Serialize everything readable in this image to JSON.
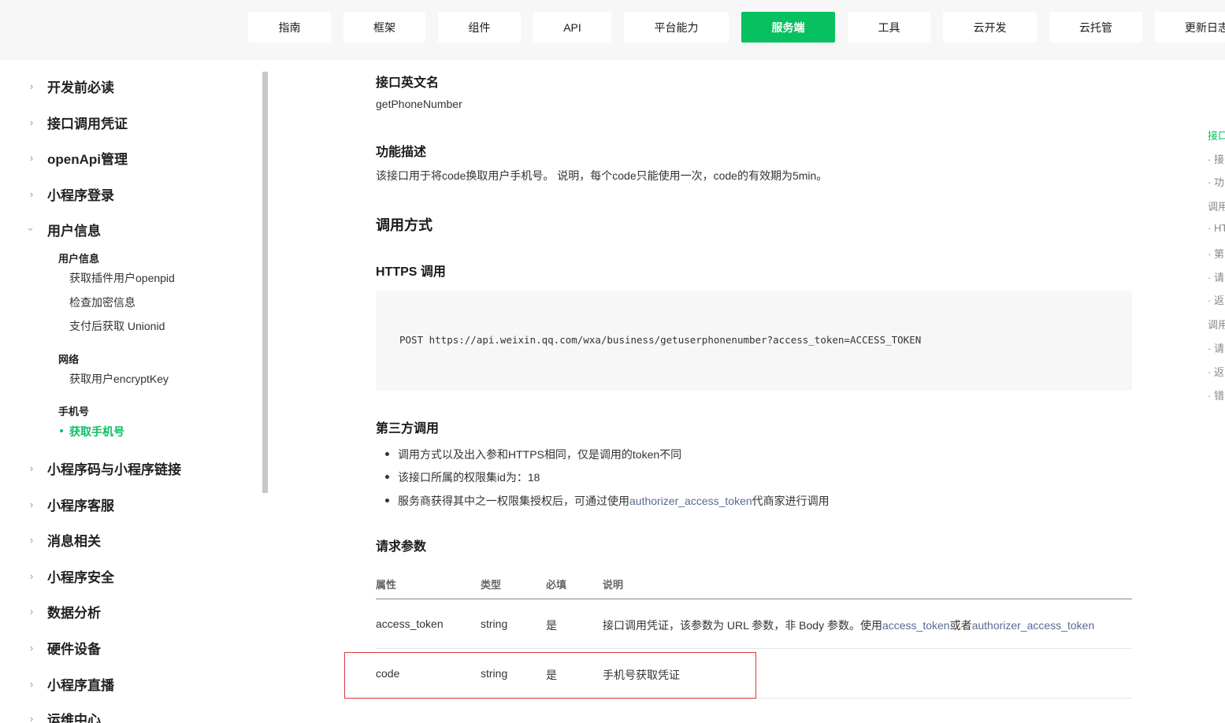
{
  "nav": {
    "tabs": [
      {
        "label": "指南"
      },
      {
        "label": "框架"
      },
      {
        "label": "组件"
      },
      {
        "label": "API"
      },
      {
        "label": "平台能力"
      },
      {
        "label": "服务端"
      },
      {
        "label": "工具"
      },
      {
        "label": "云开发"
      },
      {
        "label": "云托管"
      },
      {
        "label": "更新日志"
      }
    ],
    "active": "服务端",
    "accent": "#07c160"
  },
  "sidebar": {
    "items": [
      {
        "label": "开发前必读"
      },
      {
        "label": "接口调用凭证"
      },
      {
        "label": "openApi管理"
      },
      {
        "label": "小程序登录"
      },
      {
        "label": "用户信息"
      },
      {
        "label": "小程序码与小程序链接"
      },
      {
        "label": "小程序客服"
      },
      {
        "label": "消息相关"
      },
      {
        "label": "小程序安全"
      },
      {
        "label": "数据分析"
      },
      {
        "label": "硬件设备"
      },
      {
        "label": "小程序直播"
      },
      {
        "label": "运维中心"
      }
    ],
    "groups": {
      "user_info": {
        "title": "用户信息",
        "items": [
          "获取插件用户openpid",
          "检查加密信息",
          "支付后获取 Unionid"
        ]
      },
      "network": {
        "title": "网络",
        "items": [
          "获取用户encryptKey"
        ]
      },
      "phone": {
        "title": "手机号",
        "items": [
          "获取手机号"
        ]
      }
    }
  },
  "content": {
    "api_name_title": "接口英文名",
    "api_name": "getPhoneNumber",
    "desc_title": "功能描述",
    "desc": "该接口用于将code换取用户手机号。 说明，每个code只能使用一次，code的有效期为5min。",
    "call_title": "调用方式",
    "https_title": "HTTPS 调用",
    "https_code": "POST https://api.weixin.qq.com/wxa/business/getuserphonenumber?access_token=ACCESS_TOKEN",
    "third_title": "第三方调用",
    "third_bullets": {
      "b1": "调用方式以及出入参和HTTPS相同，仅是调用的token不同",
      "b2": "该接口所属的权限集id为：18",
      "b3_pre": "服务商获得其中之一权限集授权后，可通过使用",
      "b3_link": "authorizer_access_token",
      "b3_post": "代商家进行调用"
    },
    "params_title": "请求参数",
    "table": {
      "headers": [
        "属性",
        "类型",
        "必填",
        "说明"
      ],
      "rows": [
        {
          "name": "access_token",
          "type": "string",
          "required": "是",
          "desc_pre": "接口调用凭证，该参数为 URL 参数，非 Body 参数。使用",
          "desc_link1": "access_token",
          "desc_mid": "或者",
          "desc_link2": "authorizer_access_token"
        },
        {
          "name": "code",
          "type": "string",
          "required": "是",
          "desc_link": "手机号获取凭证"
        }
      ]
    }
  },
  "toc": {
    "items": [
      "接口",
      "· 接",
      "· 功",
      "调用",
      "· HT",
      "· 第",
      "· 请",
      "· 返",
      "调用",
      "· 请",
      "· 返",
      "· 错"
    ]
  }
}
